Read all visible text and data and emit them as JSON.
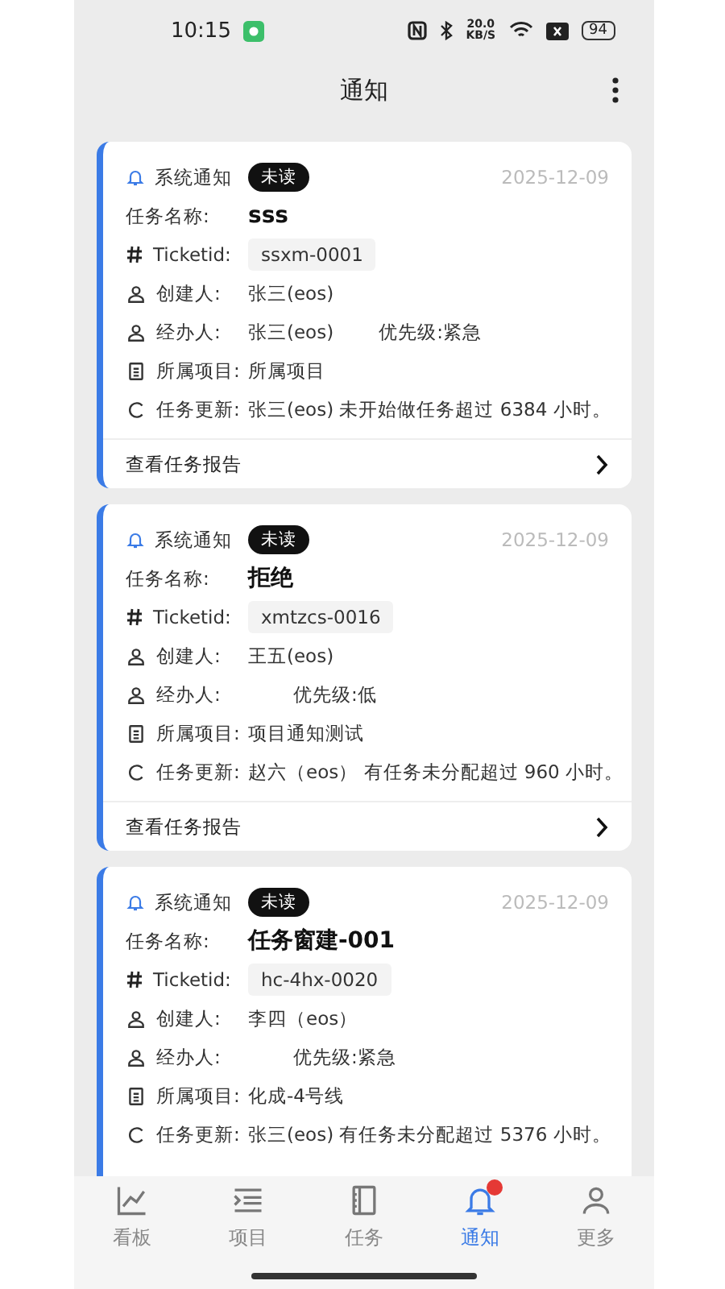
{
  "status_bar": {
    "time": "10:15",
    "net_speed": "20.0",
    "net_unit": "KB/S",
    "battery": "94"
  },
  "header": {
    "title": "通知"
  },
  "cards": [
    {
      "category": "系统通知",
      "badge": "未读",
      "date": "2025-12-09",
      "task_label": "任务名称:",
      "task_name": "sss",
      "ticket_label": "Ticketid:",
      "ticket": "ssxm-0001",
      "creator_label": "创建人:",
      "creator": "张三(eos)",
      "handler_label": "经办人:",
      "handler": "张三(eos)",
      "priority": "优先级:紧急",
      "project_label": "所属项目:",
      "project": "所属项目",
      "update_label": "任务更新:",
      "update": "张三(eos) 未开始做任务超过 6384 小时。",
      "footer": "查看任务报告"
    },
    {
      "category": "系统通知",
      "badge": "未读",
      "date": "2025-12-09",
      "task_label": "任务名称:",
      "task_name": "拒绝",
      "ticket_label": "Ticketid:",
      "ticket": "xmtzcs-0016",
      "creator_label": "创建人:",
      "creator": "王五(eos)",
      "handler_label": "经办人:",
      "priority": "优先级:低",
      "project_label": "所属项目:",
      "project": "项目通知测试",
      "update_label": "任务更新:",
      "update": "赵六（eos） 有任务未分配超过 960 小时。",
      "footer": "查看任务报告"
    },
    {
      "category": "系统通知",
      "badge": "未读",
      "date": "2025-12-09",
      "task_label": "任务名称:",
      "task_name": "任务窗建-001",
      "ticket_label": "Ticketid:",
      "ticket": "hc-4hx-0020",
      "creator_label": "创建人:",
      "creator": "李四（eos）",
      "handler_label": "经办人:",
      "priority": "优先级:紧急",
      "project_label": "所属项目:",
      "project": "化成-4号线",
      "update_label": "任务更新:",
      "update": "张三(eos) 有任务未分配超过 5376 小时。"
    }
  ],
  "tabs": [
    {
      "label": "看板",
      "kind": "chart",
      "selected": false
    },
    {
      "label": "项目",
      "kind": "list",
      "selected": false
    },
    {
      "label": "任务",
      "kind": "book",
      "selected": false
    },
    {
      "label": "通知",
      "kind": "bell",
      "selected": true,
      "badge": true
    },
    {
      "label": "更多",
      "kind": "user",
      "selected": false
    }
  ]
}
